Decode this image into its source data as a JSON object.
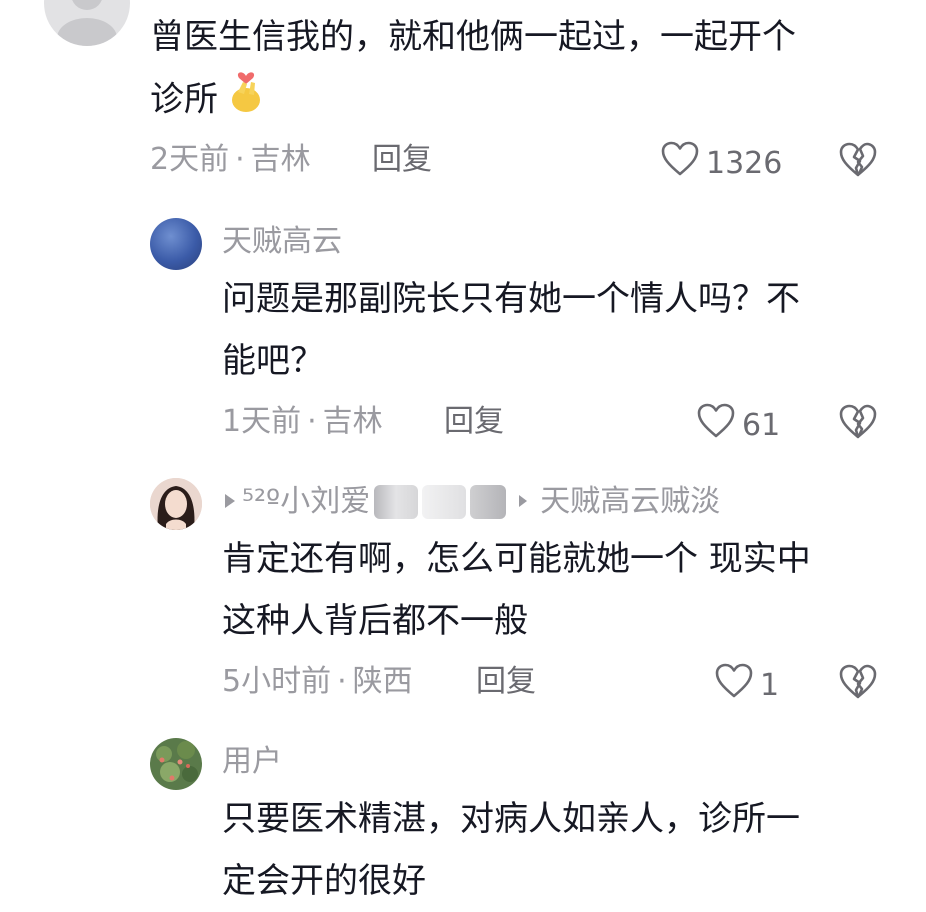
{
  "comments": [
    {
      "text_line1": "曾医生信我的，就和他俩一起过，一起开个",
      "text_line2": "诊所",
      "time": "2天前",
      "location": "吉林",
      "reply_label": "回复",
      "likes": "1326"
    },
    {
      "username": "天贼高云",
      "text_line1": "问题是那副院长只有她一个情人吗？不",
      "text_line2": "能吧？",
      "time": "1天前",
      "location": "吉林",
      "reply_label": "回复",
      "likes": "61"
    },
    {
      "username_prefix": "⁵²º小刘爱",
      "reply_target": "天贼高云贼淡",
      "text_line1": "肯定还有啊，怎么可能就她一个 现实中",
      "text_line2": "这种人背后都不一般",
      "time": "5小时前",
      "location": "陕西",
      "reply_label": "回复",
      "likes": "1"
    },
    {
      "username": "用户",
      "text_line1": "只要医术精湛，对病人如亲人，诊所一",
      "text_line2": "定会开的很好"
    }
  ],
  "separator": "·",
  "colors": {
    "text_primary": "#161823",
    "text_secondary": "#9a9aa0",
    "action": "#6a6a70",
    "background": "#ffffff"
  },
  "icons": {
    "like": "heart-outline-icon",
    "dislike": "broken-heart-icon",
    "finger_heart": "finger-heart-emoji"
  }
}
